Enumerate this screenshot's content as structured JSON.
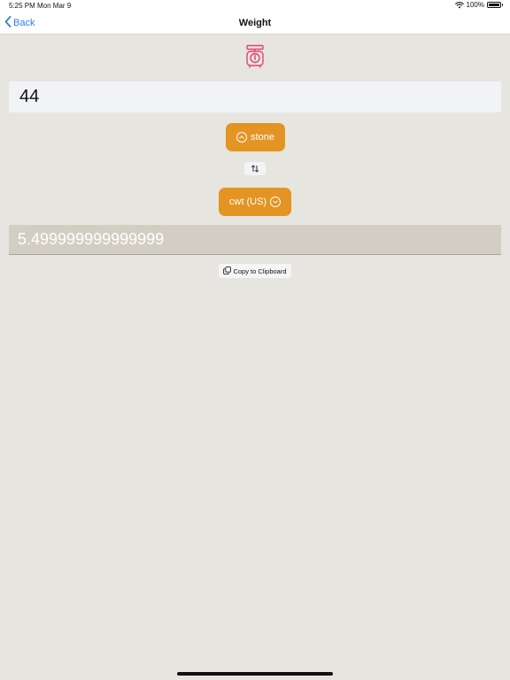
{
  "status_bar": {
    "time": "5:25 PM",
    "date": "Mon Mar 9",
    "battery": "100%",
    "battery_level": 1.0,
    "wifi_icon": "wifi-icon",
    "battery_icon": "battery-icon"
  },
  "nav": {
    "back_label": "Back",
    "back_icon": "chevron-left-icon",
    "title": "Weight"
  },
  "header_icon": "scale-icon",
  "input": {
    "value": "44"
  },
  "from_unit": {
    "label": "stone",
    "icon": "chevron-up-circle-icon"
  },
  "swap_icon": "swap-arrows-icon",
  "to_unit": {
    "label": "cwt (US)",
    "icon": "chevron-down-circle-icon"
  },
  "result": {
    "value": "5.499999999999999"
  },
  "copy": {
    "label": "Copy to Clipboard",
    "icon": "copy-icon"
  },
  "colors": {
    "accent": "#e39423",
    "link": "#2f7bf5",
    "icon_pink": "#e0446a",
    "background": "#e7e5df"
  }
}
